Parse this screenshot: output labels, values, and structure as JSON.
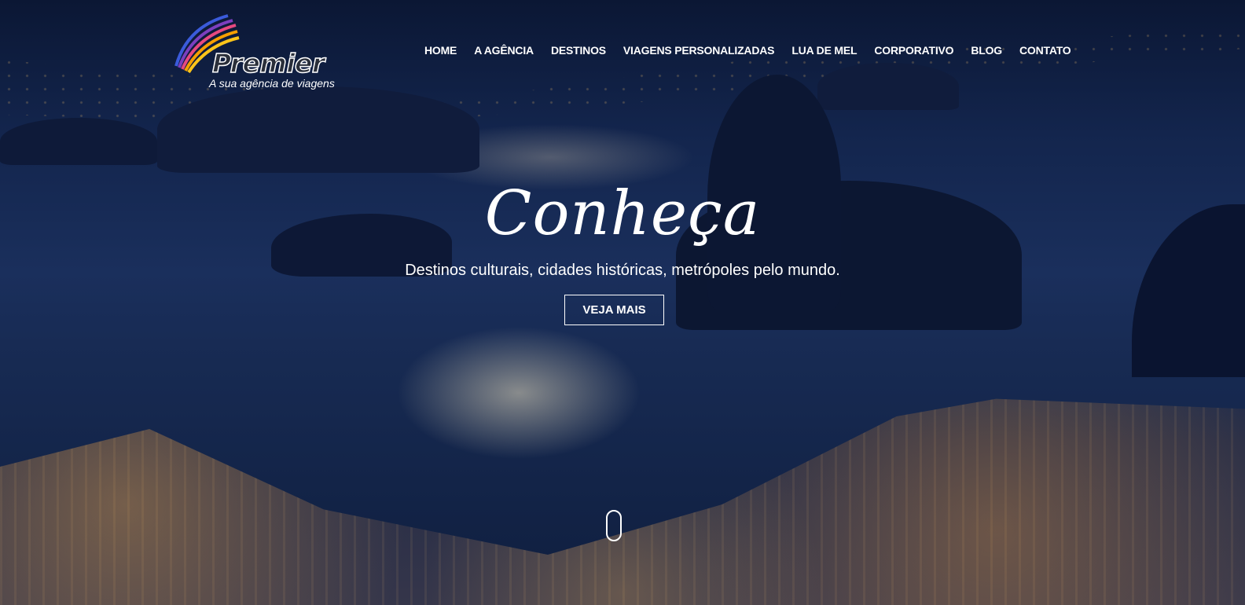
{
  "logo": {
    "name": "Premier",
    "tagline": "A sua agência de viagens"
  },
  "nav": {
    "items": [
      {
        "label": "HOME"
      },
      {
        "label": "A AGÊNCIA"
      },
      {
        "label": "DESTINOS"
      },
      {
        "label": "VIAGENS PERSONALIZADAS"
      },
      {
        "label": "LUA DE MEL"
      },
      {
        "label": "CORPORATIVO"
      },
      {
        "label": "BLOG"
      },
      {
        "label": "CONTATO"
      }
    ]
  },
  "hero": {
    "title": "Conheça",
    "subtitle": "Destinos culturais, cidades históricas, metrópoles pelo mundo.",
    "button_label": "VEJA MAIS"
  },
  "icons": {
    "logo_swoosh": "rainbow-swoosh-icon",
    "scroll": "mouse-scroll-icon"
  },
  "colors": {
    "overlay": "#13254d",
    "text": "#ffffff"
  }
}
